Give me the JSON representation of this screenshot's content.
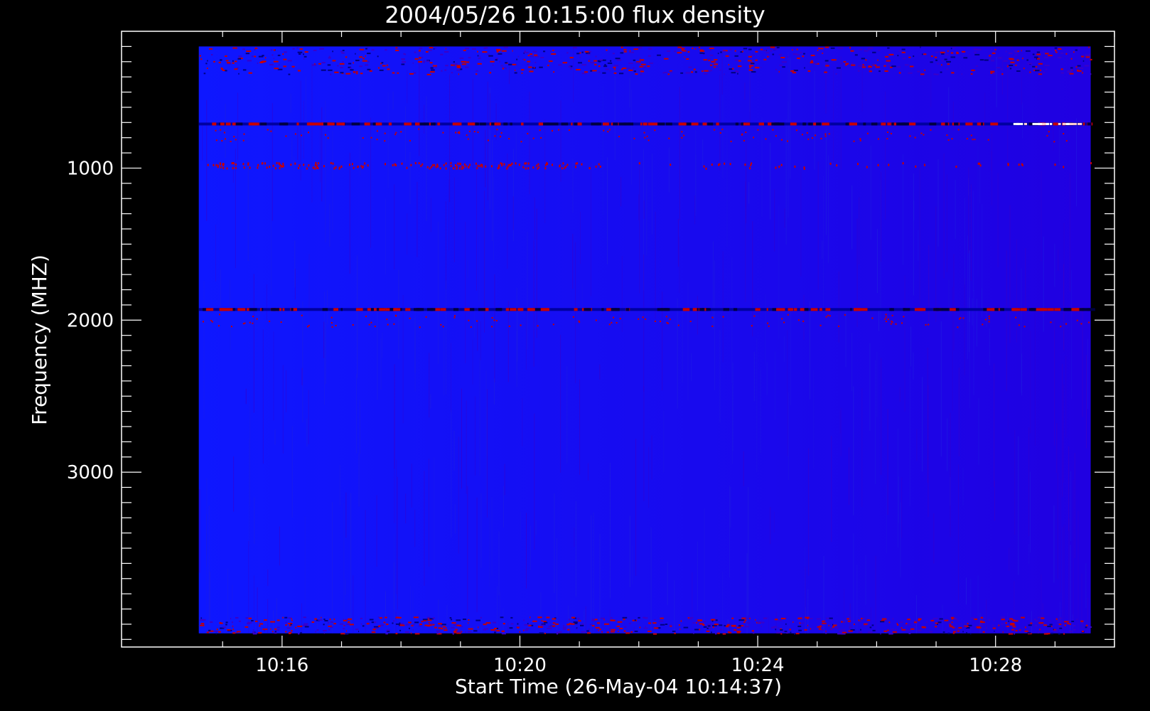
{
  "chart_data": {
    "type": "heatmap",
    "title": "2004/05/26 10:15:00 flux density",
    "xlabel": "Start Time (26-May-04 10:14:37)",
    "ylabel": "Frequency (MHZ)",
    "x_axis": {
      "unit": "minutes of day",
      "range": [
        613.3,
        630.0
      ],
      "data_start": 614.6,
      "data_end": 629.6,
      "major_ticks": [
        {
          "value": 616,
          "label": "10:16"
        },
        {
          "value": 620,
          "label": "10:20"
        },
        {
          "value": 624,
          "label": "10:24"
        },
        {
          "value": 628,
          "label": "10:28"
        }
      ],
      "minor_step": 1
    },
    "y_axis": {
      "unit": "MHz",
      "range": [
        100,
        4150
      ],
      "inverted": true,
      "data_start": 200,
      "data_end": 4060,
      "major_ticks": [
        {
          "value": 1000,
          "label": "1000"
        },
        {
          "value": 2000,
          "label": "2000"
        },
        {
          "value": 3000,
          "label": "3000"
        }
      ],
      "minor_step": 100
    },
    "colormap": {
      "low": "#0000ff",
      "mid": "#3a00c8",
      "high": "#c80000",
      "peak": "#ffffff"
    },
    "features": [
      {
        "kind": "dark-line",
        "freq": 710
      },
      {
        "kind": "dark-line",
        "freq": 1930
      },
      {
        "kind": "noisy-band",
        "freq_start": 200,
        "freq_end": 380
      },
      {
        "kind": "noisy-band",
        "freq_start": 3950,
        "freq_end": 4060
      },
      {
        "kind": "bright-segment",
        "freq": 710,
        "time_start": 628.3,
        "time_end": 629.5
      }
    ],
    "grid": false,
    "legend": "none"
  }
}
